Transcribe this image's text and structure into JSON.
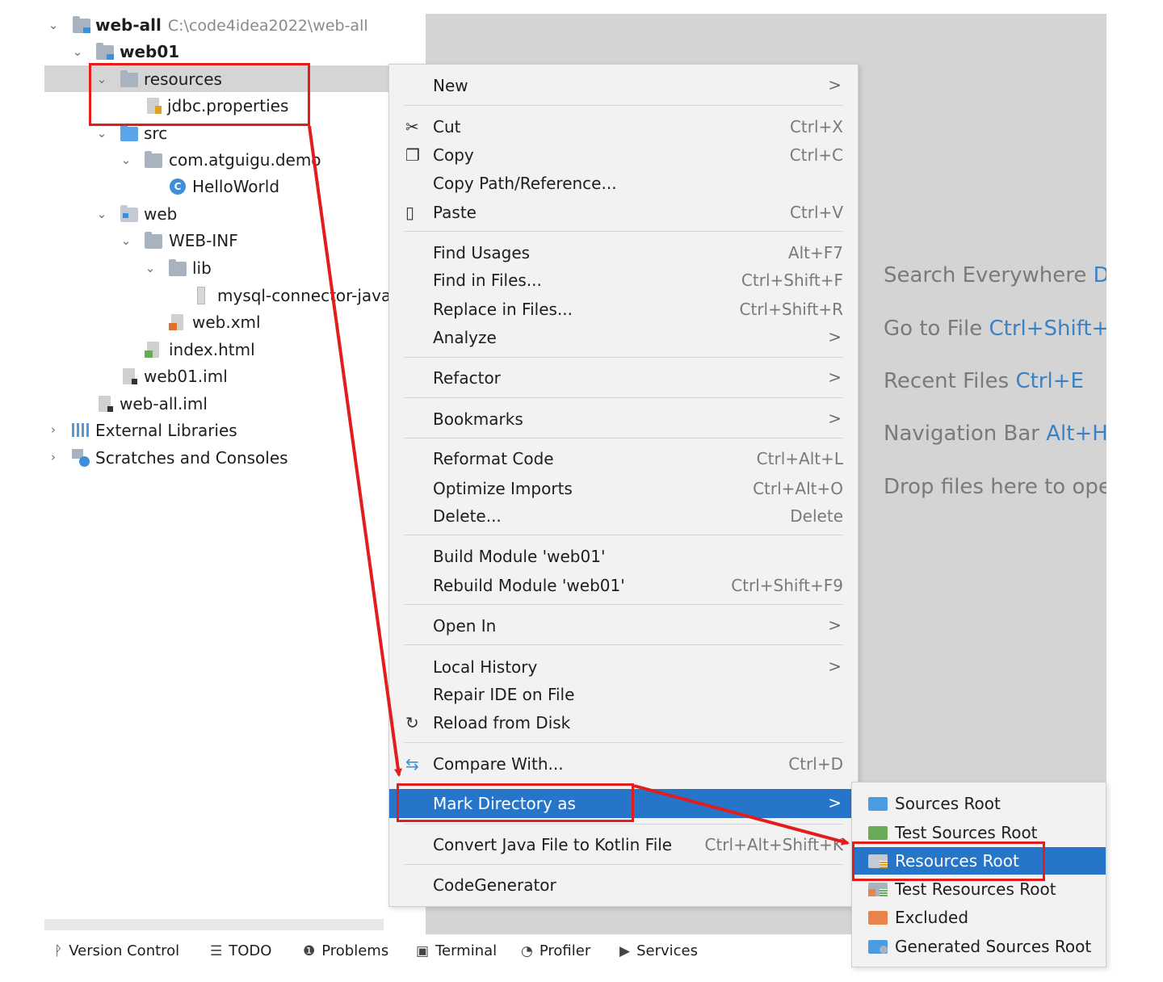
{
  "tree": {
    "root": {
      "name": "web-all",
      "path": "C:\\code4idea2022\\web-all"
    },
    "module": "web01",
    "items": [
      "resources",
      "jdbc.properties",
      "src",
      "com.atguigu.demo",
      "HelloWorld",
      "web",
      "WEB-INF",
      "lib",
      "mysql-connector-java",
      "web.xml",
      "index.html",
      "web01.iml",
      "web-all.iml",
      "External Libraries",
      "Scratches and Consoles"
    ],
    "class_badge": "C"
  },
  "editor": {
    "hints": [
      {
        "text": "Search Everywhere ",
        "key": "Double Shift"
      },
      {
        "text": "Go to File ",
        "key": "Ctrl+Shift+N"
      },
      {
        "text": "Recent Files ",
        "key": "Ctrl+E"
      },
      {
        "text": "Navigation Bar ",
        "key": "Alt+Home"
      },
      {
        "text": "Drop files here to open them",
        "key": ""
      }
    ]
  },
  "menu": {
    "items": [
      {
        "label": "New",
        "shortcut": "",
        "submenu": true
      },
      {
        "label": "Cut",
        "shortcut": "Ctrl+X",
        "icon": "scissors-icon"
      },
      {
        "label": "Copy",
        "shortcut": "Ctrl+C",
        "icon": "copy-icon"
      },
      {
        "label": "Copy Path/Reference...",
        "shortcut": ""
      },
      {
        "label": "Paste",
        "shortcut": "Ctrl+V",
        "icon": "clipboard-icon"
      },
      {
        "label": "Find Usages",
        "shortcut": "Alt+F7"
      },
      {
        "label": "Find in Files...",
        "shortcut": "Ctrl+Shift+F"
      },
      {
        "label": "Replace in Files...",
        "shortcut": "Ctrl+Shift+R"
      },
      {
        "label": "Analyze",
        "shortcut": "",
        "submenu": true
      },
      {
        "label": "Refactor",
        "shortcut": "",
        "submenu": true
      },
      {
        "label": "Bookmarks",
        "shortcut": "",
        "submenu": true
      },
      {
        "label": "Reformat Code",
        "shortcut": "Ctrl+Alt+L"
      },
      {
        "label": "Optimize Imports",
        "shortcut": "Ctrl+Alt+O"
      },
      {
        "label": "Delete...",
        "shortcut": "Delete"
      },
      {
        "label": "Build Module 'web01'",
        "shortcut": ""
      },
      {
        "label": "Rebuild Module 'web01'",
        "shortcut": "Ctrl+Shift+F9"
      },
      {
        "label": "Open In",
        "shortcut": "",
        "submenu": true
      },
      {
        "label": "Local History",
        "shortcut": "",
        "submenu": true
      },
      {
        "label": "Repair IDE on File",
        "shortcut": ""
      },
      {
        "label": "Reload from Disk",
        "shortcut": "",
        "icon": "reload-icon"
      },
      {
        "label": "Compare With...",
        "shortcut": "Ctrl+D",
        "icon": "compare-icon"
      },
      {
        "label": "Mark Directory as",
        "shortcut": "",
        "submenu": true,
        "highlighted": true
      },
      {
        "label": "Convert Java File to Kotlin File",
        "shortcut": "Ctrl+Alt+Shift+K"
      },
      {
        "label": "CodeGenerator",
        "shortcut": ""
      }
    ],
    "arrow_glyph": ">"
  },
  "submenu": {
    "items": [
      {
        "label": "Sources Root",
        "color": "#4a9be0"
      },
      {
        "label": "Test Sources Root",
        "color": "#6aab5a"
      },
      {
        "label": "Resources Root",
        "color": "#a9b3bf",
        "highlighted": true
      },
      {
        "label": "Test Resources Root",
        "color": "#a9b3bf"
      },
      {
        "label": "Excluded",
        "color": "#e8844a"
      },
      {
        "label": "Generated Sources Root",
        "color": "#4a9be0"
      }
    ]
  },
  "statusbar": {
    "tools": [
      {
        "label": "Version Control",
        "icon": "branch-icon"
      },
      {
        "label": "TODO",
        "icon": "list-icon"
      },
      {
        "label": "Problems",
        "icon": "problems-icon"
      },
      {
        "label": "Terminal",
        "icon": "terminal-icon"
      },
      {
        "label": "Profiler",
        "icon": "profiler-icon"
      },
      {
        "label": "Services",
        "icon": "services-icon"
      }
    ]
  },
  "colors": {
    "highlight": "#2675c8",
    "annotation": "#e11d1d",
    "editor_bg": "#d4d4d4"
  }
}
